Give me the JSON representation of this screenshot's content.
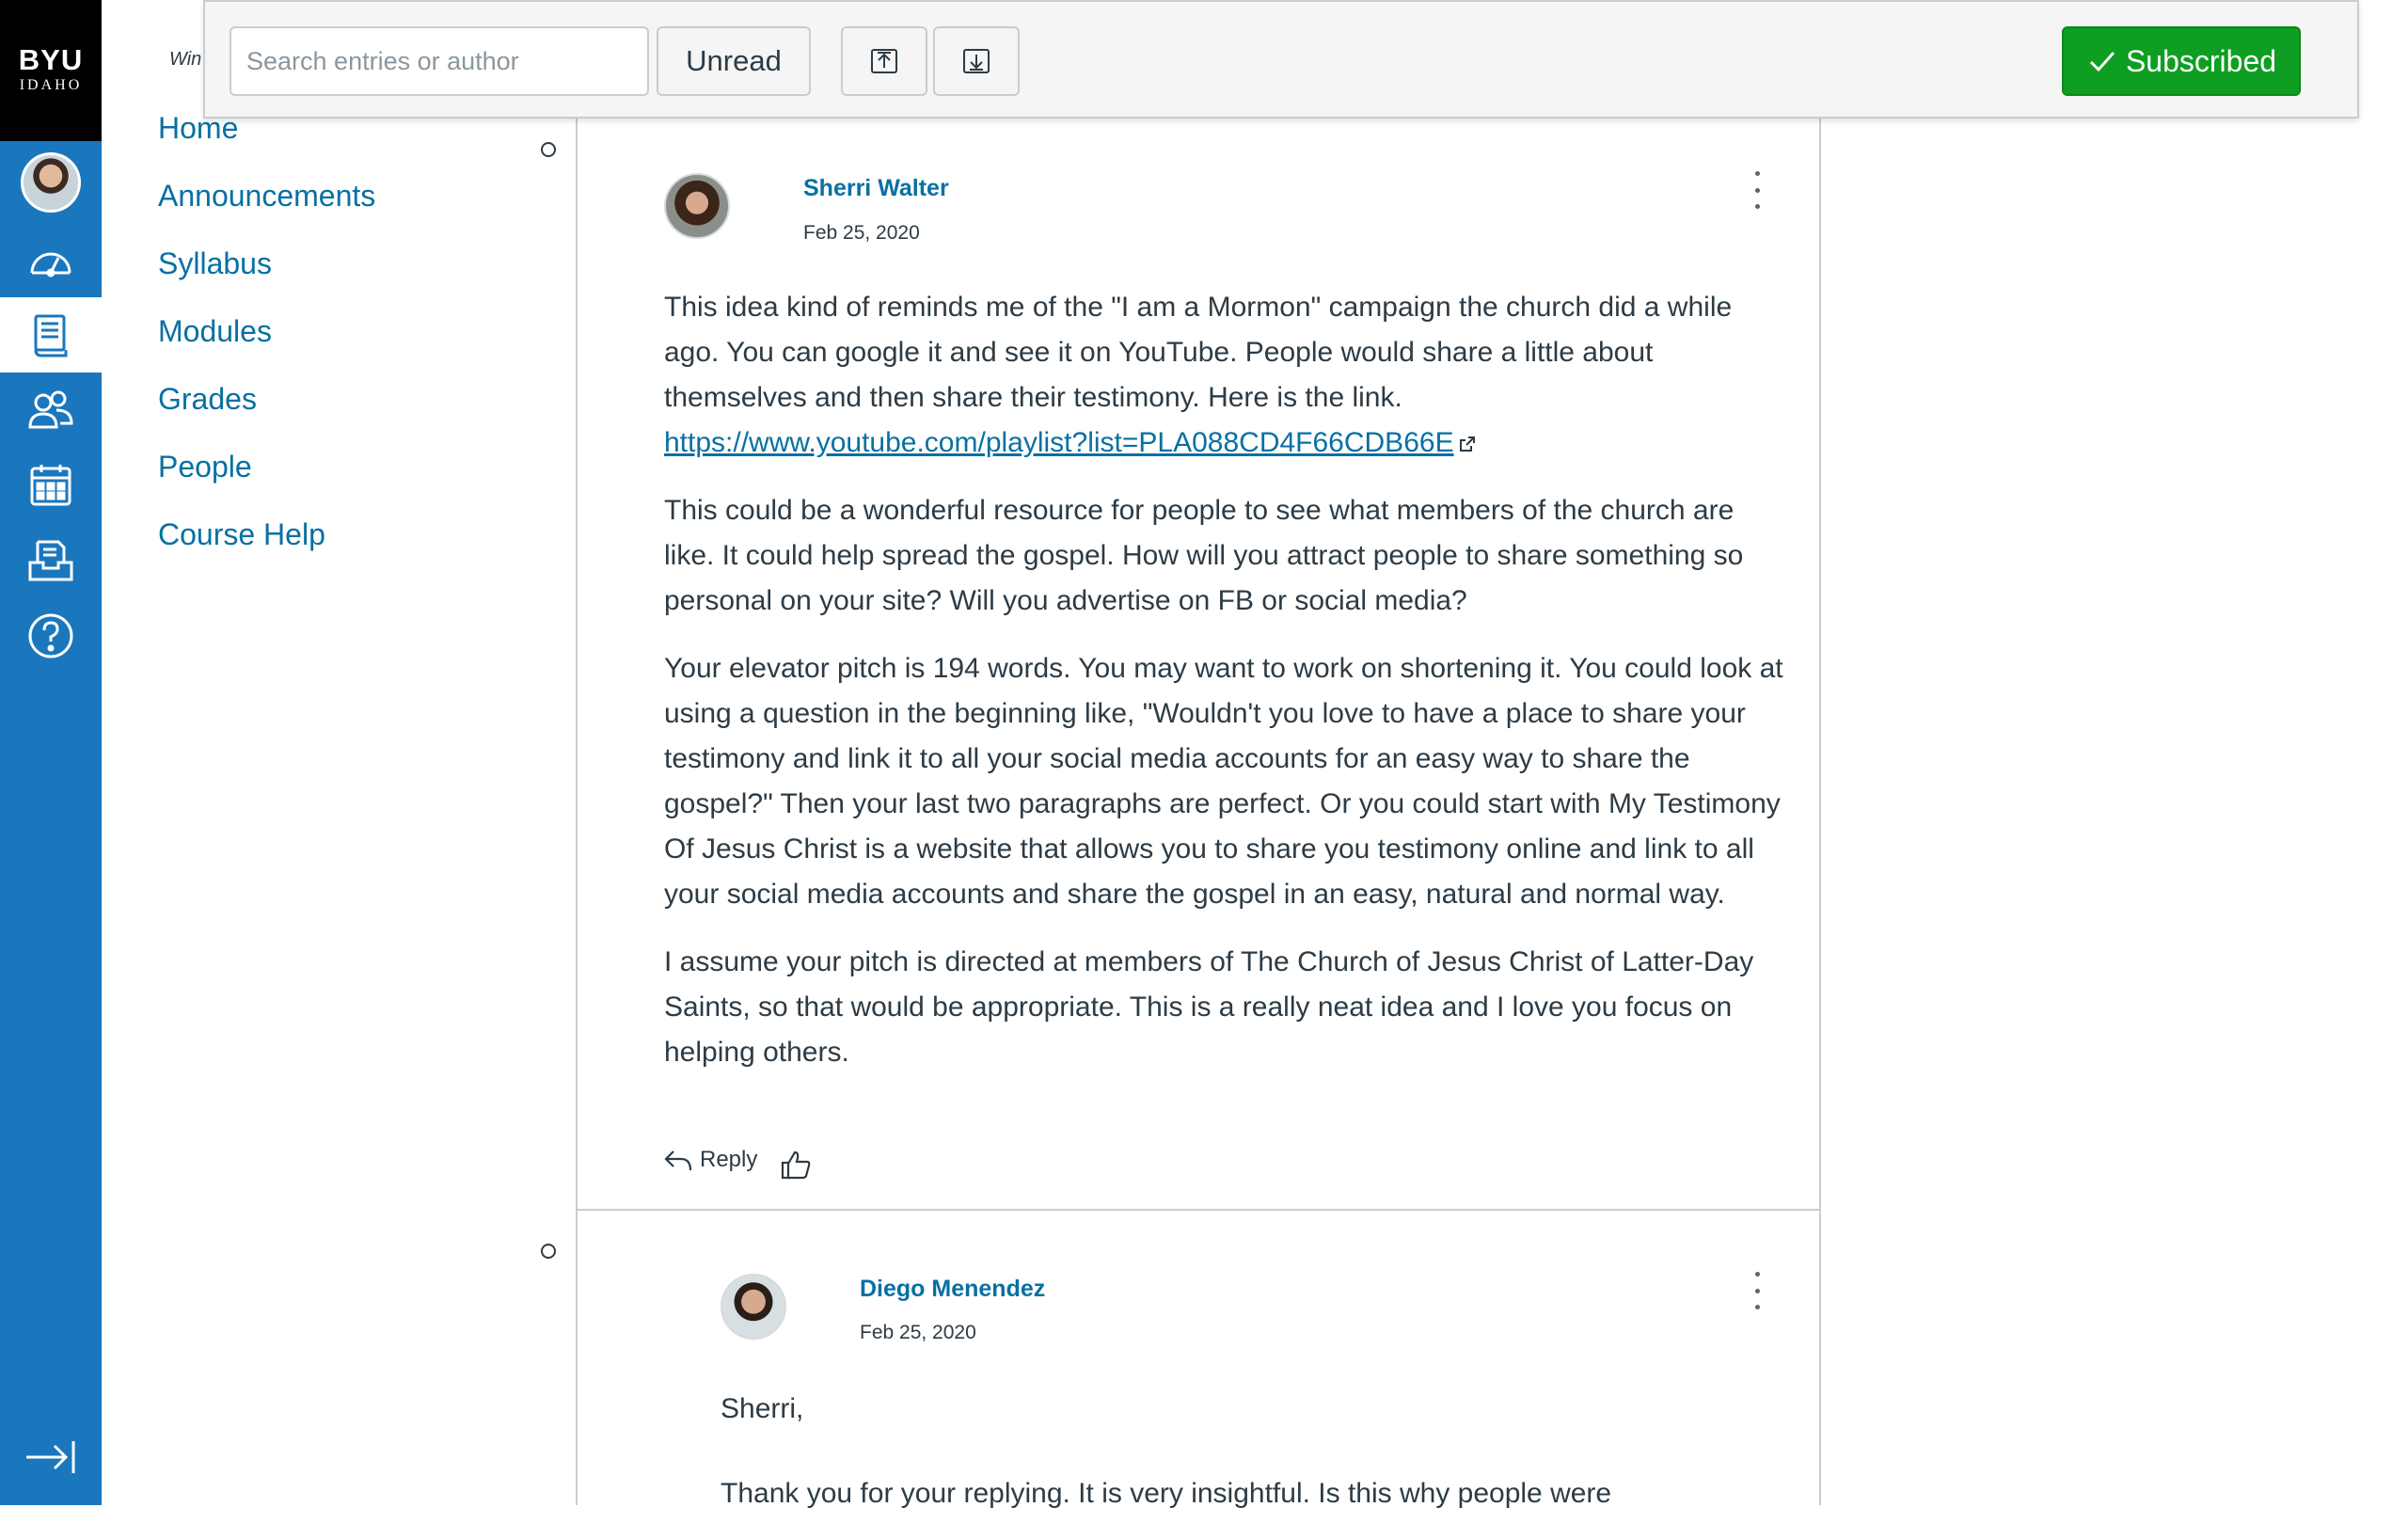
{
  "global_nav": {
    "logo_line1": "BYU",
    "logo_line2": "IDAHO",
    "items": [
      {
        "icon": "account-avatar"
      },
      {
        "icon": "dashboard-icon"
      },
      {
        "icon": "courses-icon",
        "active": true
      },
      {
        "icon": "groups-icon"
      },
      {
        "icon": "calendar-icon"
      },
      {
        "icon": "inbox-icon"
      },
      {
        "icon": "help-icon"
      }
    ],
    "collapse_icon": "collapse-nav-icon",
    "accent": "#1a77bd"
  },
  "breadcrumb_fragment": "Win",
  "toolbar": {
    "search_placeholder": "Search entries or author",
    "unread_label": "Unread",
    "collapse_icon": "collapse-threads-icon",
    "expand_icon": "expand-threads-icon",
    "subscribed_label": "Subscribed",
    "subscribed_color": "#0e9e22"
  },
  "course_nav": {
    "items": [
      "Home",
      "Announcements",
      "Syllabus",
      "Modules",
      "Grades",
      "People",
      "Course Help"
    ]
  },
  "entries": [
    {
      "author": "Sherri Walter",
      "date": "Feb 25, 2020",
      "paragraphs": [
        "This idea kind of reminds me of the \"I am a Mormon\" campaign the church did a while ago. You can google it and see it on YouTube. People would share a little about themselves and then share their testimony.  Here is the link.",
        "This could be a wonderful resource for people to see what members of the church are like. It could help spread the gospel. How will you attract people to share something so personal on your site? Will you advertise on FB or social media?",
        "Your elevator pitch is 194 words. You may want to work on shortening it. You could look at using a question in the beginning like, \"Wouldn't you love to have a place to share your testimony and link it to all your social media accounts for an easy way to share the gospel?\" Then your last two paragraphs are perfect. Or you could start with My Testimony Of Jesus Christ is a website that allows you to share you testimony online and link to all your social media accounts and share the gospel in an easy, natural and normal way.",
        "I assume your pitch is directed at members of The Church of Jesus Christ of Latter-Day Saints, so that would be appropriate. This is a really neat idea and I love you focus on helping others."
      ],
      "link": "https://www.youtube.com/playlist?list=PLA088CD4F66CDB66E",
      "reply_label": "Reply"
    },
    {
      "author": "Diego Menendez",
      "date": "Feb 25, 2020",
      "paragraphs": [
        "Sherri,",
        "Thank you for your replying. It is very insightful. Is this why people were"
      ]
    }
  ]
}
